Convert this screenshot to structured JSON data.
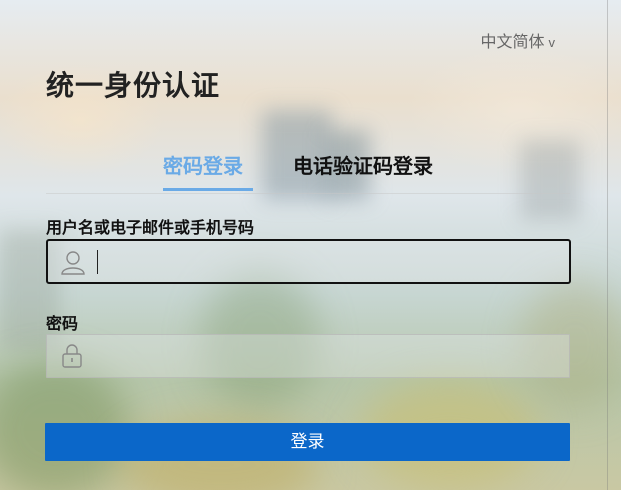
{
  "language_selector": {
    "label": "中文简体",
    "chevron": "v"
  },
  "title": "统一身份认证",
  "tabs": [
    {
      "label": "密码登录",
      "active": true
    },
    {
      "label": "电话验证码登录",
      "active": false
    }
  ],
  "username": {
    "label": "用户名或电子邮件或手机号码",
    "value": "",
    "placeholder": "",
    "icon": "user-icon"
  },
  "password": {
    "label": "密码",
    "value": "",
    "placeholder": "",
    "icon": "lock-icon"
  },
  "login_button": {
    "label": "登录"
  },
  "colors": {
    "accent": "#6aaae6",
    "button": "#0b67c9"
  }
}
